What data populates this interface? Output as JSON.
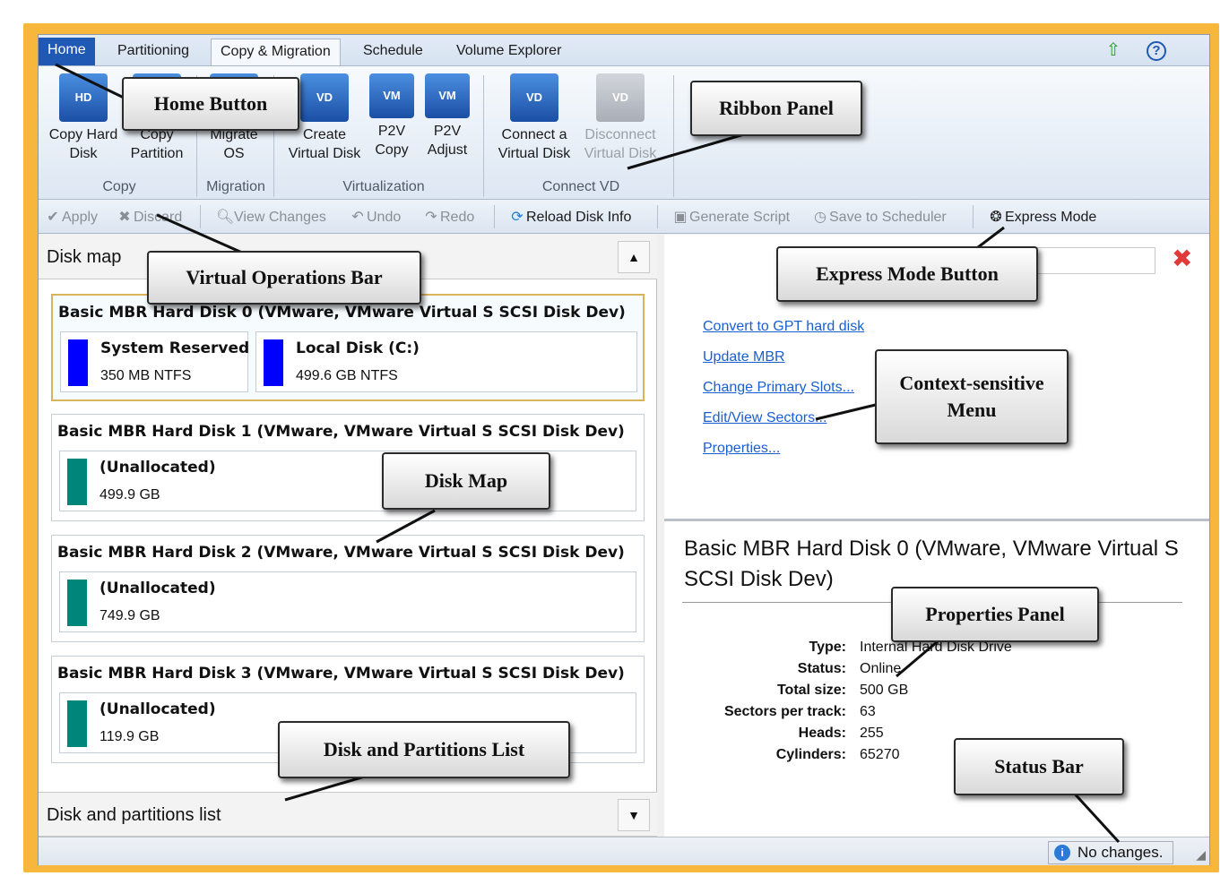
{
  "tabs": [
    "Home",
    "Partitioning",
    "Copy & Migration",
    "Schedule",
    "Volume Explorer"
  ],
  "ribbon": {
    "buttons": [
      {
        "line1": "Copy Hard",
        "line2": "Disk",
        "icon": "copy-disk-icon"
      },
      {
        "line1": "Copy",
        "line2": "Partition",
        "icon": "copy-partition-icon"
      },
      {
        "line1": "Migrate",
        "line2": "OS",
        "icon": "migrate-os-icon"
      },
      {
        "line1": "Create",
        "line2": "Virtual Disk",
        "icon": "create-virtual-disk-icon"
      },
      {
        "line1": "P2V",
        "line2": "Copy",
        "icon": "p2v-copy-icon"
      },
      {
        "line1": "P2V",
        "line2": "Adjust",
        "icon": "p2v-adjust-icon"
      },
      {
        "line1": "Connect a",
        "line2": "Virtual Disk",
        "icon": "connect-vd-icon"
      },
      {
        "line1": "Disconnect",
        "line2": "Virtual Disk",
        "icon": "disconnect-vd-icon"
      }
    ],
    "groups": [
      "Copy",
      "Migration",
      "Virtualization",
      "Connect VD"
    ]
  },
  "ops": {
    "apply": "Apply",
    "discard": "Discard",
    "view_changes": "View Changes",
    "undo": "Undo",
    "redo": "Redo",
    "reload": "Reload Disk Info",
    "generate_script": "Generate Script",
    "save_scheduler": "Save to Scheduler",
    "express_mode": "Express Mode"
  },
  "left": {
    "disk_map_title": "Disk map",
    "list_title": "Disk and partitions list",
    "disks": [
      {
        "title": "Basic MBR Hard Disk 0 (VMware, VMware Virtual S SCSI Disk Dev)",
        "partitions": [
          {
            "name": "System Reserved",
            "size": "350 MB NTFS",
            "color": "#0000ff"
          },
          {
            "name": "Local Disk (C:)",
            "size": "499.6 GB NTFS",
            "color": "#0000ff"
          }
        ]
      },
      {
        "title": "Basic MBR Hard Disk 1 (VMware, VMware Virtual S SCSI Disk Dev)",
        "partitions": [
          {
            "name": "(Unallocated)",
            "size": "499.9 GB",
            "color": "#00857a"
          }
        ]
      },
      {
        "title": "Basic MBR Hard Disk 2 (VMware, VMware Virtual S SCSI Disk Dev)",
        "partitions": [
          {
            "name": "(Unallocated)",
            "size": "749.9 GB",
            "color": "#00857a"
          }
        ]
      },
      {
        "title": "Basic MBR Hard Disk 3 (VMware, VMware Virtual S SCSI Disk Dev)",
        "partitions": [
          {
            "name": "(Unallocated)",
            "size": "119.9 GB",
            "color": "#00857a"
          }
        ]
      }
    ]
  },
  "context_menu": [
    "Convert to GPT hard disk",
    "Update MBR",
    "Change Primary Slots...",
    "Edit/View Sectors...",
    "Properties..."
  ],
  "properties": {
    "title": "Basic MBR Hard Disk 0 (VMware, VMware Virtual S SCSI Disk Dev)",
    "rows": [
      {
        "label": "Type:",
        "value": "Internal Hard Disk Drive"
      },
      {
        "label": "Status:",
        "value": "Online"
      },
      {
        "label": "Total size:",
        "value": "500 GB"
      },
      {
        "label": "Sectors per track:",
        "value": "63"
      },
      {
        "label": "Heads:",
        "value": "255"
      },
      {
        "label": "Cylinders:",
        "value": "65270"
      }
    ]
  },
  "status_text": "No changes.",
  "callouts": {
    "home_button": "Home Button",
    "ribbon_panel": "Ribbon Panel",
    "virtual_ops": "Virtual Operations Bar",
    "express_mode": "Express Mode Button",
    "context_menu_1": "Context-sensitive",
    "context_menu_2": "Menu",
    "disk_map": "Disk Map",
    "properties_panel": "Properties Panel",
    "status_bar": "Status Bar",
    "disk_partitions": "Disk and Partitions List"
  }
}
